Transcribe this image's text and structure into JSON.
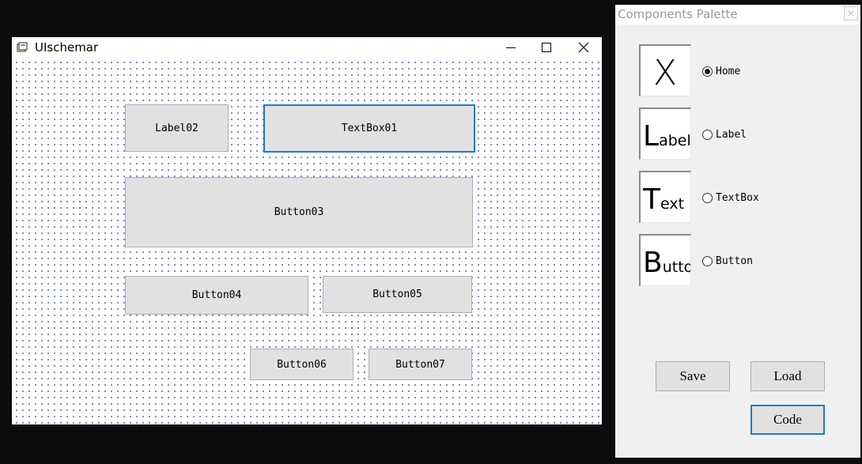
{
  "window": {
    "title": "UIschemar"
  },
  "canvas": {
    "controls": [
      {
        "id": "label02",
        "text": "Label02"
      },
      {
        "id": "textbox01",
        "text": "TextBox01"
      },
      {
        "id": "button03",
        "text": "Button03"
      },
      {
        "id": "button04",
        "text": "Button04"
      },
      {
        "id": "button05",
        "text": "Button05"
      },
      {
        "id": "button06",
        "text": "Button06"
      },
      {
        "id": "button07",
        "text": "Button07"
      }
    ]
  },
  "palette": {
    "title": "Components Palette",
    "items": [
      {
        "tile_text": "X",
        "radio_label": "Home",
        "checked": true
      },
      {
        "tile_first": "L",
        "tile_rest": "abel",
        "radio_label": "Label",
        "checked": false
      },
      {
        "tile_first": "T",
        "tile_rest": "ext",
        "radio_label": "TextBox",
        "checked": false
      },
      {
        "tile_first": "B",
        "tile_rest": "utton",
        "radio_label": "Button",
        "checked": false
      }
    ],
    "buttons": {
      "save": "Save",
      "load": "Load",
      "code": "Code"
    }
  },
  "colors": {
    "focus_border": "#1a7ad6",
    "grid_dot": "#3d4aa8",
    "control_face": "#e1e1e1"
  },
  "icons": [
    "app-icon",
    "minimize-icon",
    "maximize-icon",
    "close-icon"
  ]
}
